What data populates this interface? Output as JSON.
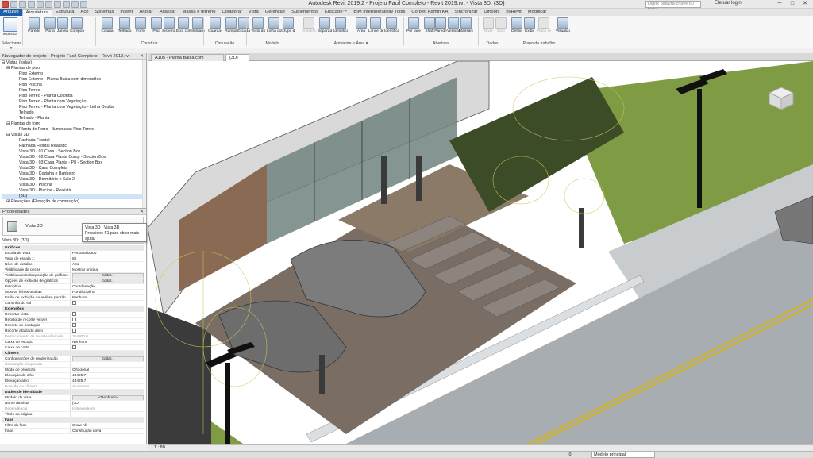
{
  "titlebar": {
    "title": "Autodesk Revit 2019.2 - Projeto Facil Completo - Revit 2019.rvt - Vista 3D: {3D}",
    "search_placeholder": "Digite palavra-chave ou frase",
    "login": "Efetuar login"
  },
  "tabs": [
    "Arquivo",
    "Arquitetura",
    "Estrutura",
    "Aço",
    "Sistemas",
    "Inserir",
    "Anotar",
    "Analisar",
    "Massa e terreno",
    "Colaborar",
    "Vista",
    "Gerenciar",
    "Suplementos",
    "Enscape™",
    "BIM Interoperability Tools",
    "Corbett Admin KA",
    "Sincronizar",
    "Difroots",
    "pyRevit",
    "Modificar"
  ],
  "ribbon": {
    "buttons": [
      "Modificar",
      "Parede",
      "Porta",
      "Janela",
      "Componente",
      "Coluna",
      "Telhado",
      "Forro",
      "Piso",
      "Sistema cortina",
      "Eixo cortina",
      "Montante",
      "Guarda-corpo",
      "Rampa",
      "Escada",
      "Texto do modelo",
      "Linha do modelo",
      "Grupo de modelos",
      "Ambiente",
      "Separador de ambiente",
      "Identificar ambiente",
      "Área",
      "Limite de área",
      "Identificar área",
      "Por face",
      "Shaft",
      "Parede",
      "Vertical",
      "Mansarda",
      "Nível",
      "Eixo",
      "Definir",
      "Exibir",
      "Plano de referência",
      "Visualizador"
    ],
    "groups": [
      "Selecionar ▾",
      "Construir",
      "Circulação",
      "Modelo",
      "Ambiente e Área ▾",
      "Abertura",
      "Dados",
      "Plano de trabalho"
    ]
  },
  "project_browser": {
    "title": "Navegador de projeto - Projeto Facil Completo - Revit 2019.rvt",
    "items": [
      {
        "label": "⊟ Vistas (todas)",
        "level": 0
      },
      {
        "label": "⊟ Plantas de piso",
        "level": 1
      },
      {
        "label": "Piso Externo",
        "level": 2
      },
      {
        "label": "Piso Externo - Planta Baixa com dimensões",
        "level": 2
      },
      {
        "label": "Piso Piscina",
        "level": 2
      },
      {
        "label": "Piso Terreo",
        "level": 2
      },
      {
        "label": "Piso Terreo - Planta Colorida",
        "level": 2
      },
      {
        "label": "Piso Terreo - Planta com Vegetação",
        "level": 2
      },
      {
        "label": "Piso Terreo - Planta com Vegetação - Linha Oculta",
        "level": 2
      },
      {
        "label": "Telhado",
        "level": 2
      },
      {
        "label": "Telhado - Planta",
        "level": 2
      },
      {
        "label": "⊟ Plantas de forro",
        "level": 1
      },
      {
        "label": "Planta de Forro - Iluminacao Piso Terreo",
        "level": 2
      },
      {
        "label": "⊟ Vistas 3D",
        "level": 1
      },
      {
        "label": "Fachada Frontal",
        "level": 2
      },
      {
        "label": "Fachada Frontal Realistic",
        "level": 2
      },
      {
        "label": "Vista 3D - 01 Casa - Section Box",
        "level": 2
      },
      {
        "label": "Vista 3D - 02 Casa Planta Comp - Section Box",
        "level": 2
      },
      {
        "label": "Vista 3D - 03 Casa Planta - P8 - Section Box",
        "level": 2
      },
      {
        "label": "Vista 3D - Casa Completa",
        "level": 2
      },
      {
        "label": "Vista 3D - Cozinha e Banheiro",
        "level": 2
      },
      {
        "label": "Vista 3D - Dormitório e Sala 2",
        "level": 2
      },
      {
        "label": "Vista 3D - Piscina",
        "level": 2
      },
      {
        "label": "Vista 3D - Piscina - Realistic",
        "level": 2
      },
      {
        "label": "{3D}",
        "level": 2,
        "selected": true
      },
      {
        "label": "⊞ Elevações (Elevação de construção)",
        "level": 1
      }
    ]
  },
  "properties": {
    "title": "Propriedades",
    "type_name": "Vista 3D",
    "tooltip_title": "Vista 3D : Vista 3D",
    "tooltip_hint": "Pressione F1 para obter mais ajuda",
    "instance": "Vista 3D: {3D}",
    "edit_type": "Editar tipo",
    "rows": [
      {
        "k": "Gráficos",
        "v": "",
        "group": true
      },
      {
        "k": "Escala de vista",
        "v": "Personalizado"
      },
      {
        "k": "Valor de escala    1:",
        "v": "80"
      },
      {
        "k": "Nível de detalhe",
        "v": "Alto"
      },
      {
        "k": "Visibilidade de peças",
        "v": "Mostrar original"
      },
      {
        "k": "Visibilidade/Sobreposição de gráficos",
        "v": "Editar...",
        "btn": true
      },
      {
        "k": "Opções de exibição de gráficos",
        "v": "Editar...",
        "btn": true
      },
      {
        "k": "Disciplina",
        "v": "Coordenação"
      },
      {
        "k": "Mostrar linhas ocultas",
        "v": "Por disciplina"
      },
      {
        "k": "Estilo de exibição de análise padrão",
        "v": "Nenhum"
      },
      {
        "k": "Caminho do sol",
        "v": "",
        "chk": true
      },
      {
        "k": "Extensões",
        "v": "",
        "group": true
      },
      {
        "k": "Recortar vista",
        "v": "",
        "chk": true
      },
      {
        "k": "Região de recorte visível",
        "v": "",
        "chk": true
      },
      {
        "k": "Recorte de anotação",
        "v": "",
        "chk": true
      },
      {
        "k": "Recorte afastado ativo",
        "v": "",
        "chk": true
      },
      {
        "k": "Deslocamento de recorte afastado",
        "v": "304800.0",
        "dim": true
      },
      {
        "k": "Caixa de escopo",
        "v": "Nenhum"
      },
      {
        "k": "Caixa de corte",
        "v": "",
        "chk": true
      },
      {
        "k": "Câmera",
        "v": "",
        "group": true
      },
      {
        "k": "Configurações de renderização",
        "v": "Editar...",
        "btn": true
      },
      {
        "k": "Orientação bloqueada",
        "v": "",
        "dim": true
      },
      {
        "k": "Modo de projeção",
        "v": "Ortogonal"
      },
      {
        "k": "Elevação do olho",
        "v": "43425.7"
      },
      {
        "k": "Elevação alvo",
        "v": "43425.7"
      },
      {
        "k": "Posição da câmera",
        "v": "Ajustando",
        "dim": true
      },
      {
        "k": "Dados de identidade",
        "v": "",
        "group": true
      },
      {
        "k": "Modelo de vista",
        "v": "<Nenhum>",
        "btn": true
      },
      {
        "k": "Nome da vista",
        "v": "{3D}"
      },
      {
        "k": "Dependência",
        "v": "Independente",
        "dim": true
      },
      {
        "k": "Título da página",
        "v": ""
      },
      {
        "k": "Fase",
        "v": "",
        "group": true
      },
      {
        "k": "Filtro da fase",
        "v": "Show All"
      },
      {
        "k": "Fase",
        "v": "Construção nova"
      }
    ],
    "help_link": "Ajuda de propriedades",
    "apply": "Aplicar"
  },
  "doc_tabs": [
    "A105 - Planta Baixa com Dimensões",
    "{3D}"
  ],
  "view_control": {
    "scale": "1 : 80"
  },
  "status": {
    "zero": ":0",
    "model": "Modelo principal"
  },
  "colors": {
    "file_tab": "#1d5fa8",
    "grass": "#7f9b43",
    "paving": "#b8bdc2",
    "road": "#a9aeb2",
    "road_line": "#d8b51a"
  },
  "icons": [
    "modify-arrow-icon",
    "wall-icon",
    "door-icon",
    "window-icon",
    "navcube-icon"
  ]
}
